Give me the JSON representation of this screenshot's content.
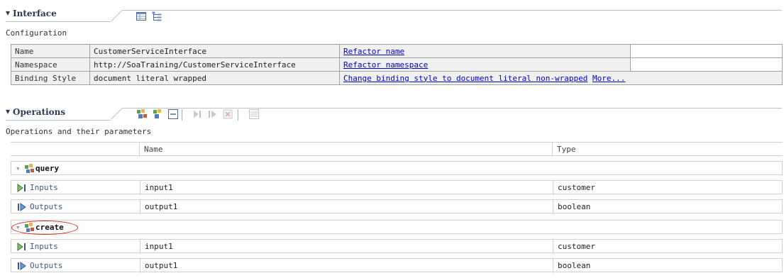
{
  "interface": {
    "title": "Interface",
    "toggle": "▾",
    "subtitle": "Configuration",
    "rows": [
      {
        "label": "Name",
        "value": "CustomerServiceInterface",
        "links": [
          "Refactor name"
        ]
      },
      {
        "label": "Namespace",
        "value": "http://SoaTraining/CustomerServiceInterface",
        "links": [
          "Refactor namespace"
        ]
      },
      {
        "label": "Binding Style",
        "value": "document literal wrapped",
        "links": [
          "Change binding style to document literal non-wrapped",
          "More..."
        ]
      }
    ]
  },
  "operations": {
    "title": "Operations",
    "toggle": "▾",
    "subtitle": "Operations and their parameters",
    "columns": [
      "Name",
      "Type"
    ],
    "items": [
      {
        "name": "query",
        "params": [
          {
            "kind": "Inputs",
            "name": "input1",
            "type": "customer"
          },
          {
            "kind": "Outputs",
            "name": "output1",
            "type": "boolean"
          }
        ]
      },
      {
        "name": "create",
        "params": [
          {
            "kind": "Inputs",
            "name": "input1",
            "type": "customer"
          },
          {
            "kind": "Outputs",
            "name": "output1",
            "type": "boolean"
          }
        ]
      }
    ]
  },
  "colors": {
    "link": "#0000cc",
    "header_text": "#2a3a58",
    "highlight_ellipse": "#e0201a"
  }
}
